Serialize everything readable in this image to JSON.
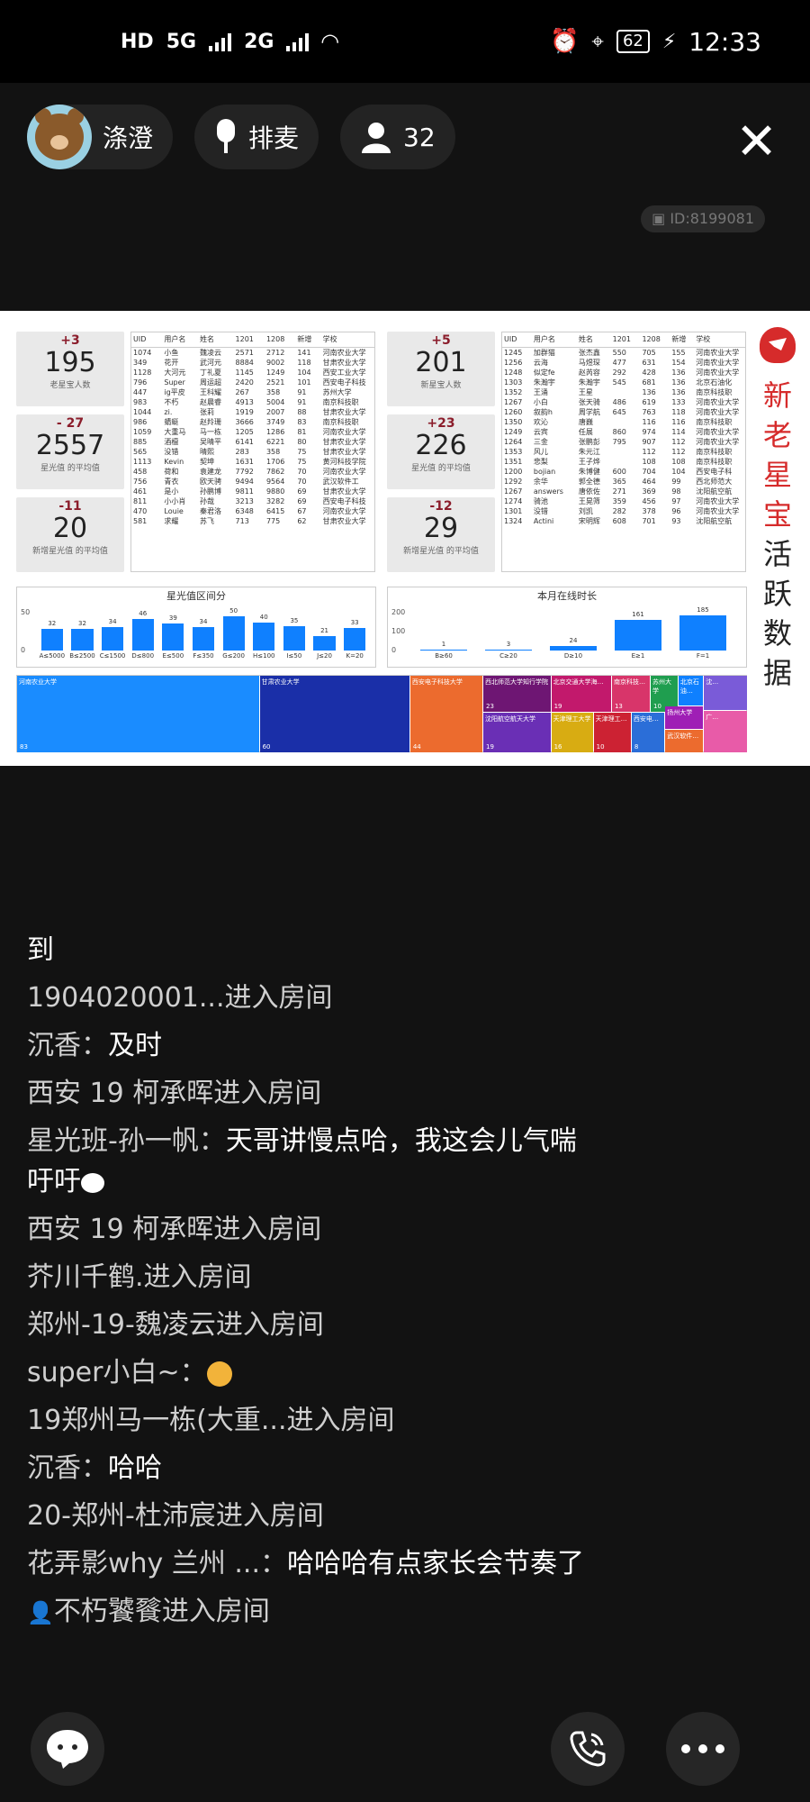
{
  "status_bar": {
    "network": "HD",
    "sim1": "5G",
    "sim2": "2G",
    "battery": "62",
    "time": "12:33"
  },
  "header": {
    "host_name": "涤澄",
    "mic_label": "排麦",
    "audience_count": "32",
    "room_id": "ID:8199081"
  },
  "slide": {
    "side_title": [
      "新",
      "老",
      "星",
      "宝",
      "活",
      "跃",
      "数",
      "据"
    ],
    "cards": [
      {
        "delta": "+3",
        "value": "195",
        "label": "老星宝人数"
      },
      {
        "delta": "- 27",
        "value": "2557",
        "label": "星光值 的平均值"
      },
      {
        "delta": "-11",
        "value": "20",
        "label": "新增星光值 的平均值"
      },
      {
        "delta": "+5",
        "value": "201",
        "label": "新星宝人数"
      },
      {
        "delta": "+23",
        "value": "226",
        "label": "星光值 的平均值"
      },
      {
        "delta": "-12",
        "value": "29",
        "label": "新增星光值 的平均值"
      }
    ],
    "table_headers": [
      "UID",
      "用户名",
      "姓名",
      "1201",
      "1208",
      "新增",
      "学校"
    ],
    "table_left": [
      [
        "1074",
        "小鱼",
        "魏凌云",
        "2571",
        "2712",
        "141",
        "河南农业大学"
      ],
      [
        "349",
        "花开",
        "武河元",
        "8884",
        "9002",
        "118",
        "甘肃农业大学"
      ],
      [
        "1128",
        "大河元",
        "丁礼夏",
        "1145",
        "1249",
        "104",
        "西安工业大学"
      ],
      [
        "796",
        "Super",
        "周运超",
        "2420",
        "2521",
        "101",
        "西安电子科技"
      ],
      [
        "447",
        "ig平皮",
        "王科耀",
        "267",
        "358",
        "91",
        "苏州大学"
      ],
      [
        "983",
        "不朽",
        "赵晨睿",
        "4913",
        "5004",
        "91",
        "南京科技职"
      ],
      [
        "1044",
        "zi.",
        "张莉",
        "1919",
        "2007",
        "88",
        "甘肃农业大学"
      ],
      [
        "986",
        "蜻蜓",
        "赵羚珊",
        "3666",
        "3749",
        "83",
        "南京科技职"
      ],
      [
        "1059",
        "大重马",
        "马一栋",
        "1205",
        "1286",
        "81",
        "河南农业大学"
      ],
      [
        "885",
        "酒檀",
        "吴晴平",
        "6141",
        "6221",
        "80",
        "甘肃农业大学"
      ],
      [
        "565",
        "没错",
        "晴熙",
        "283",
        "358",
        "75",
        "甘肃农业大学"
      ],
      [
        "1113",
        "Kevin",
        "契坤",
        "1631",
        "1706",
        "75",
        "黄河科技学院"
      ],
      [
        "458",
        "荷和",
        "袁建龙",
        "7792",
        "7862",
        "70",
        "河南农业大学"
      ],
      [
        "756",
        "青衣",
        "欧天骋",
        "9494",
        "9564",
        "70",
        "武汉软件工"
      ],
      [
        "461",
        "是小",
        "孙鹏博",
        "9811",
        "9880",
        "69",
        "甘肃农业大学"
      ],
      [
        "811",
        "小小肖",
        "孙哉",
        "3213",
        "3282",
        "69",
        "西安电子科技"
      ],
      [
        "470",
        "Louie",
        "秦君洛",
        "6348",
        "6415",
        "67",
        "河南农业大学"
      ],
      [
        "581",
        "求耀",
        "苏飞",
        "713",
        "775",
        "62",
        "甘肃农业大学"
      ]
    ],
    "table_right": [
      [
        "1245",
        "加群猫",
        "张杰鑫",
        "550",
        "705",
        "155",
        "河南农业大学"
      ],
      [
        "1256",
        "云海",
        "马煜琛",
        "477",
        "631",
        "154",
        "河南农业大学"
      ],
      [
        "1248",
        "似定fe",
        "赵芮容",
        "292",
        "428",
        "136",
        "河南农业大学"
      ],
      [
        "1303",
        "朱瀚宇",
        "朱瀚宇",
        "545",
        "681",
        "136",
        "北京石油化"
      ],
      [
        "1352",
        "王涌",
        "王星",
        "",
        "136",
        "136",
        "南京科技职"
      ],
      [
        "1267",
        "小白",
        "张天骑",
        "486",
        "619",
        "133",
        "河南农业大学"
      ],
      [
        "1260",
        "叙韵h",
        "周学航",
        "645",
        "763",
        "118",
        "河南农业大学"
      ],
      [
        "1350",
        "欢沁",
        "唐巍",
        "",
        "116",
        "116",
        "南京科技职"
      ],
      [
        "1249",
        "云宾",
        "任展",
        "860",
        "974",
        "114",
        "河南农业大学"
      ],
      [
        "1264",
        "三金",
        "张鹏彭",
        "795",
        "907",
        "112",
        "河南农业大学"
      ],
      [
        "1353",
        "风儿",
        "朱元江",
        "",
        "112",
        "112",
        "南京科技职"
      ],
      [
        "1351",
        "悲梨",
        "王子烨",
        "",
        "108",
        "108",
        "南京科技职"
      ],
      [
        "1200",
        "bojian",
        "朱博健",
        "600",
        "704",
        "104",
        "西安电子科"
      ],
      [
        "1292",
        "余华",
        "郭全德",
        "365",
        "464",
        "99",
        "西北师范大"
      ],
      [
        "1267",
        "answers",
        "唐依佐",
        "271",
        "369",
        "98",
        "沈阳航空航"
      ],
      [
        "1274",
        "骑池",
        "王晃筛",
        "359",
        "456",
        "97",
        "河南农业大学"
      ],
      [
        "1301",
        "没错",
        "刘凯",
        "282",
        "378",
        "96",
        "河南农业大学"
      ],
      [
        "1324",
        "Actini",
        "宋明辉",
        "608",
        "701",
        "93",
        "沈阳航空航"
      ]
    ],
    "chart_data": [
      {
        "type": "bar",
        "title": "星光值区间分",
        "categories": [
          "A≤5000",
          "B≤2500",
          "C≤1500",
          "D≤800",
          "E≤500",
          "F≤350",
          "G≤200",
          "H≤100",
          "I≤50",
          "J≤20",
          "K=20"
        ],
        "values": [
          32,
          32,
          34,
          46,
          39,
          34,
          50,
          40,
          35,
          21,
          33
        ],
        "yticks": [
          "50",
          "0"
        ],
        "ylim": [
          0,
          55
        ]
      },
      {
        "type": "bar",
        "title": "本月在线时长",
        "categories": [
          "B≥60",
          "C≥20",
          "D≥10",
          "E≥1",
          "F=1"
        ],
        "values": [
          1,
          3,
          24,
          161,
          185
        ],
        "yticks": [
          "200",
          "100",
          "0"
        ],
        "ylim": [
          0,
          200
        ]
      },
      {
        "type": "heatmap",
        "title": "",
        "cells": [
          {
            "name": "河南农业大学",
            "value": "83",
            "color": "#1a8cff"
          },
          {
            "name": "甘肃农业大学",
            "value": "60",
            "color": "#1a2fa8"
          },
          {
            "name": "西安电子科技大学",
            "value": "44",
            "color": "#ec6b2e"
          },
          {
            "name": "西北师范大学知行学院",
            "value": "23",
            "color": "#6e1673"
          },
          {
            "name": "沈阳航空航天大学",
            "value": "19",
            "color": "#6a2fb5"
          },
          {
            "name": "北京交通大学海…",
            "value": "19",
            "color": "#c2196c"
          },
          {
            "name": "天津理工大学",
            "value": "16",
            "color": "#d8ac12"
          },
          {
            "name": "南京科技…",
            "value": "13",
            "color": "#d8356a"
          },
          {
            "name": "天津理工…",
            "value": "10",
            "color": "#cc2233"
          },
          {
            "name": "苏州大学",
            "value": "10",
            "color": "#1f9e4f"
          },
          {
            "name": "西安电…",
            "value": "8",
            "color": "#2b6ed8"
          },
          {
            "name": "北京石油…",
            "value": "",
            "color": "#0f80ff"
          },
          {
            "name": "扬州大学",
            "value": "",
            "color": "#9f1fb5"
          },
          {
            "name": "武汉软件…",
            "value": "",
            "color": "#ec6b2e"
          },
          {
            "name": "沈…",
            "value": "",
            "color": "#7a5bd8"
          },
          {
            "name": "广…",
            "value": "",
            "color": "#e85ba8"
          }
        ]
      }
    ]
  },
  "chat": [
    {
      "name": "",
      "text": "到",
      "kind": "text"
    },
    {
      "name": "",
      "text": "1904020001...进入房间",
      "kind": "sys"
    },
    {
      "name": "沉香：",
      "text": "及时",
      "kind": "msg"
    },
    {
      "name": "",
      "text": "西安 19 柯承晖进入房间",
      "kind": "sys"
    },
    {
      "name": "星光班-孙一帆：",
      "text": "天哥讲慢点哈，我这会儿气喘吁吁",
      "kind": "msg"
    },
    {
      "name": "",
      "text": "西安 19 柯承晖进入房间",
      "kind": "sys"
    },
    {
      "name": "",
      "text": "芥川千鹤.进入房间",
      "kind": "sys"
    },
    {
      "name": "",
      "text": "郑州-19-魏凌云进入房间",
      "kind": "sys"
    },
    {
      "name": "super小白~：",
      "text": "",
      "kind": "msg"
    },
    {
      "name": "",
      "text": "19郑州马一栋(大重...进入房间",
      "kind": "sys"
    },
    {
      "name": "沉香：",
      "text": "哈哈",
      "kind": "msg"
    },
    {
      "name": "",
      "text": "20-郑州-杜沛宸进入房间",
      "kind": "sys"
    },
    {
      "name": "花弄影why 兰州 ...：",
      "text": "哈哈哈有点家长会节奏了",
      "kind": "msg"
    },
    {
      "name": "",
      "text": "不朽饕餮进入房间",
      "kind": "sys"
    }
  ],
  "icons": {
    "chat": "chat-bubble-icon",
    "call": "phone-call-icon",
    "more": "more-dots-icon",
    "close": "close-icon",
    "mic": "microphone-icon",
    "user": "person-icon",
    "camera": "video-camera-icon"
  }
}
